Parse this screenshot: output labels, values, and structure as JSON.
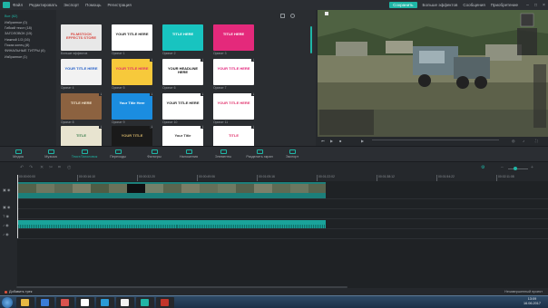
{
  "menu": {
    "items": [
      "Файл",
      "Редактировать",
      "Экспорт",
      "Помощь",
      "Регистрация"
    ],
    "save_label": "Сохранить",
    "more_effects_label": "Больше эффектов",
    "messages_label": "Сообщения",
    "purchase_label": "Приобретение"
  },
  "categories": [
    {
      "label": "Все (62)",
      "active": true
    },
    {
      "label": "Избранное (0)",
      "active": false
    },
    {
      "label": "Гибкий текст (18)",
      "active": false
    },
    {
      "label": "ЗАГОЛОВОК (15)",
      "active": false
    },
    {
      "label": "Нижний 1/3 (16)",
      "active": false
    },
    {
      "label": "Показ конец (8)",
      "active": false
    },
    {
      "label": "ФИНАЛЬНЫЕ ТИТРЫ (6)",
      "active": false
    },
    {
      "label": "Избранное (1)",
      "active": false
    }
  ],
  "templates": [
    {
      "caption": "Больше эффектов",
      "title": "FILMSTOCK EFFECTS STORE",
      "bg": "#e8e8e8",
      "fg": "#d9453e"
    },
    {
      "caption": "Оринат 1",
      "title": "YOUR TITLE HERE",
      "bg": "#ffffff",
      "fg": "#222222"
    },
    {
      "caption": "Оринат 2",
      "title": "TITLE HERE",
      "bg": "#18c4c0",
      "fg": "#ffffff"
    },
    {
      "caption": "Оринат 3",
      "title": "TITLE HERE",
      "bg": "#e4297b",
      "fg": "#ffffff"
    },
    {
      "caption": "Оринат 4",
      "title": "YOUR TITLE HERE",
      "bg": "#f2f2f2",
      "fg": "#2560c8"
    },
    {
      "caption": "Оринат 5",
      "title": "YOUR TITLE HERE",
      "bg": "#f7c93b",
      "fg": "#e0306a"
    },
    {
      "caption": "Оринат 6",
      "title": "YOUR HEADLINE HERE",
      "bg": "#ffffff",
      "fg": "#111111"
    },
    {
      "caption": "Оринат 7",
      "title": "YOUR TITLE HERE",
      "bg": "#ffffff",
      "fg": "#e21f78"
    },
    {
      "caption": "Оринат 8",
      "title": "TITLE HERE",
      "bg": "#8c6240",
      "fg": "#f4e7cf"
    },
    {
      "caption": "Оринат 9",
      "title": "Your Title Here",
      "bg": "#1b8de0",
      "fg": "#ffffff"
    },
    {
      "caption": "Оринат 10",
      "title": "YOUR TITLE HERE",
      "bg": "#ffffff",
      "fg": "#222222"
    },
    {
      "caption": "Оринат 11",
      "title": "YOUR TITLE HERE",
      "bg": "#ffffff",
      "fg": "#e0306a"
    },
    {
      "caption": "",
      "title": "TITLE",
      "bg": "#e8e4d0",
      "fg": "#3a7d4c"
    },
    {
      "caption": "",
      "title": "YOUR TITLE",
      "bg": "#1a1a1a",
      "fg": "#d4b56a"
    },
    {
      "caption": "",
      "title": "Your Title",
      "bg": "#ffffff",
      "fg": "#333333"
    },
    {
      "caption": "",
      "title": "TITLE",
      "bg": "#ffffff",
      "fg": "#e0306a"
    }
  ],
  "tabs": [
    {
      "label": "Медиа",
      "icon": "media-icon"
    },
    {
      "label": "Музыка",
      "icon": "music-icon"
    },
    {
      "label": "Текст/Заголовок",
      "icon": "text-icon",
      "active": true
    },
    {
      "label": "Переходы",
      "icon": "transitions-icon"
    },
    {
      "label": "Фильтры",
      "icon": "filters-icon"
    },
    {
      "label": "Наложения",
      "icon": "overlays-icon"
    },
    {
      "label": "Элементы",
      "icon": "elements-icon"
    },
    {
      "label": "Разделить экран",
      "icon": "split-screen-icon"
    },
    {
      "label": "Экспорт",
      "icon": "export-icon"
    }
  ],
  "timecode": "00:00:00:00",
  "ruler": [
    "00:00:00:00",
    "00:00:16:10",
    "00:00:32:20",
    "00:00:49:06",
    "00:01:05:16",
    "00:01:22:02",
    "00:01:38:12",
    "00:01:54:22",
    "00:02:11:08"
  ],
  "statusbar": {
    "add_label": "Добавить трек",
    "register_label": "Незавершенный проект"
  },
  "taskbar": {
    "time": "13:09",
    "date": "16.06.2017"
  }
}
